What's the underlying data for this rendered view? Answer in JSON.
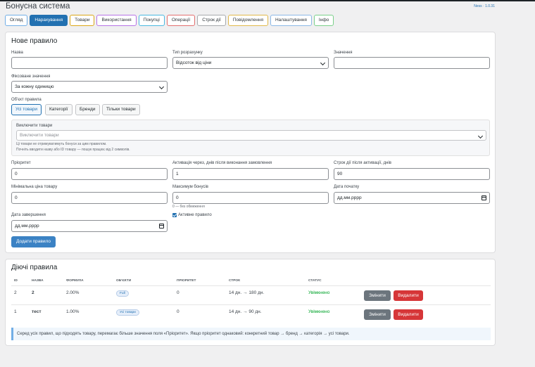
{
  "page": {
    "title": "Бонусна система",
    "version": "Ness · 1.0.31"
  },
  "tabs": [
    {
      "label": "Огляд",
      "color": "#72aee6",
      "active": false
    },
    {
      "label": "Нарахування",
      "color": "#2271b1",
      "active": true
    },
    {
      "label": "Товари",
      "color": "#dba617",
      "active": false
    },
    {
      "label": "Використання",
      "color": "#b673e6",
      "active": false
    },
    {
      "label": "Покупці",
      "color": "#4ab8e0",
      "active": false
    },
    {
      "label": "Операції",
      "color": "#e26f6f",
      "active": false
    },
    {
      "label": "Строк дії",
      "color": "#a7aaad",
      "active": false
    },
    {
      "label": "Повідомлення",
      "color": "#e0b84a",
      "active": false
    },
    {
      "label": "Налаштування",
      "color": "#8cb8e6",
      "active": false
    },
    {
      "label": "Інфо",
      "color": "#7ad08a",
      "active": false
    }
  ],
  "form": {
    "heading": "Нове правило",
    "name_label": "Назва",
    "name_value": "",
    "calc_type_label": "Тип розрахунку",
    "calc_type_value": "Відсоток від ціни",
    "value_label": "Значення",
    "value_value": "",
    "fixed_label": "Фіксоване значення",
    "fixed_value": "За кожну одиницю",
    "object_label": "Об'єкт правила",
    "object_options": [
      "Усі товари",
      "Категорії",
      "Бренди",
      "Тільки товари"
    ],
    "exclude_label": "Виключити товари",
    "exclude_placeholder": "Виключити товари",
    "exclude_hint1": "Ці товари не отримуватимуть бонуси за цим правилом.",
    "exclude_hint2": "Почніть вводити назву або ID товару — пошук працює від 2 символів.",
    "priority_label": "Пріоритет",
    "priority_value": "0",
    "activation_label": "Активація через, днів після виконання замовлення",
    "activation_value": "1",
    "validity_label": "Строк дії після активації, днів",
    "validity_value": "90",
    "min_price_label": "Мінімальна ціна товару",
    "min_price_value": "0",
    "max_bonus_label": "Максимум бонусів",
    "max_bonus_value": "0",
    "max_bonus_hint": "0 — без обмеження",
    "start_date_label": "Дата початку",
    "start_date_value": "дд.мм.рррр",
    "end_date_label": "Дата завершення",
    "end_date_value": "дд.мм.рррр",
    "active_label": "Активне правило",
    "submit_label": "Додати правило"
  },
  "rules": {
    "heading": "Діючі правила",
    "columns": [
      "ID",
      "Назва",
      "Формула",
      "Об'єкти",
      "Пріоритет",
      "Строк",
      "Статус"
    ],
    "rows": [
      {
        "id": "2",
        "name": "2",
        "formula": "2.00%",
        "objects": "Full",
        "priority": "0",
        "term": "14 дн. → 180 дн.",
        "status": "Увімкнено",
        "edit": "Змінити",
        "delete": "Видалити"
      },
      {
        "id": "1",
        "name": "тест",
        "formula": "1.00%",
        "objects": "Усі товари",
        "priority": "0",
        "term": "14 дн. → 90 дн.",
        "status": "Увімкнено",
        "edit": "Змінити",
        "delete": "Видалити"
      }
    ],
    "note": "Серед усіх правил, що підходять товару, перемагає більше значення поля «Пріоритет». Якщо пріоритет однаковий: конкретний товар → бренд → категорія → усі товари."
  }
}
